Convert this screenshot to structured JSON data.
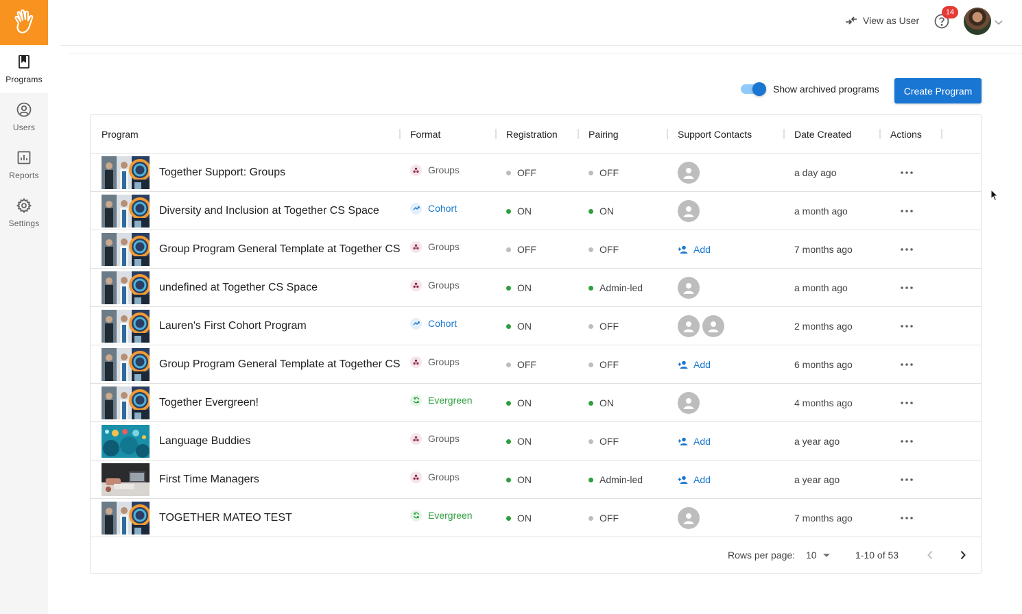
{
  "sidebar": {
    "items": [
      {
        "label": "Programs",
        "icon": "bookmark-icon",
        "active": true
      },
      {
        "label": "Users",
        "icon": "user-circle-icon",
        "active": false
      },
      {
        "label": "Reports",
        "icon": "chart-icon",
        "active": false
      },
      {
        "label": "Settings",
        "icon": "gear-icon",
        "active": false
      }
    ]
  },
  "header": {
    "view_as_user": "View as User",
    "notification_count": "14"
  },
  "controls": {
    "show_archived_label": "Show archived programs",
    "create_program_label": "Create Program"
  },
  "table": {
    "columns": [
      "Program",
      "Format",
      "Registration",
      "Pairing",
      "Support Contacts",
      "Date Created",
      "Actions"
    ],
    "rows": [
      {
        "name": "Together Support: Groups",
        "format": "Groups",
        "registration": "OFF",
        "pairing": "OFF",
        "contacts": 1,
        "contact_label": "",
        "date": "a day ago",
        "thumb": "office"
      },
      {
        "name": "Diversity and Inclusion at Together CS Space",
        "format": "Cohort",
        "registration": "ON",
        "pairing": "ON",
        "contacts": 1,
        "contact_label": "",
        "date": "a month ago",
        "thumb": "office"
      },
      {
        "name": "Group Program General Template at Together CS Space",
        "format": "Groups",
        "registration": "OFF",
        "pairing": "OFF",
        "contacts": 0,
        "contact_label": "Add",
        "date": "7 months ago",
        "thumb": "office"
      },
      {
        "name": "undefined at Together CS Space",
        "format": "Groups",
        "registration": "ON",
        "pairing": "Admin-led",
        "contacts": 1,
        "contact_label": "",
        "date": "a month ago",
        "thumb": "office"
      },
      {
        "name": "Lauren's First Cohort Program",
        "format": "Cohort",
        "registration": "ON",
        "pairing": "OFF",
        "contacts": 2,
        "contact_label": "",
        "date": "2 months ago",
        "thumb": "office"
      },
      {
        "name": "Group Program General Template at Together CS Space",
        "format": "Groups",
        "registration": "OFF",
        "pairing": "OFF",
        "contacts": 0,
        "contact_label": "Add",
        "date": "6 months ago",
        "thumb": "office"
      },
      {
        "name": "Together Evergreen!",
        "format": "Evergreen",
        "registration": "ON",
        "pairing": "ON",
        "contacts": 1,
        "contact_label": "",
        "date": "4 months ago",
        "thumb": "office"
      },
      {
        "name": "Language Buddies",
        "format": "Groups",
        "registration": "ON",
        "pairing": "OFF",
        "contacts": 0,
        "contact_label": "Add",
        "date": "a year ago",
        "thumb": "teal"
      },
      {
        "name": "First Time Managers",
        "format": "Groups",
        "registration": "ON",
        "pairing": "Admin-led",
        "contacts": 0,
        "contact_label": "Add",
        "date": "a year ago",
        "thumb": "desk"
      },
      {
        "name": "TOGETHER MATEO TEST",
        "format": "Evergreen",
        "registration": "ON",
        "pairing": "OFF",
        "contacts": 1,
        "contact_label": "",
        "date": "7 months ago",
        "thumb": "office"
      }
    ]
  },
  "pagination": {
    "rows_per_page_label": "Rows per page:",
    "rows_per_page_value": "10",
    "range": "1-10 of 53"
  },
  "colors": {
    "brand_orange": "#f7931e",
    "primary_blue": "#1976d2",
    "on_green": "#2e9e3e",
    "off_gray": "#bdbdbd",
    "badge_red": "#e53935"
  }
}
